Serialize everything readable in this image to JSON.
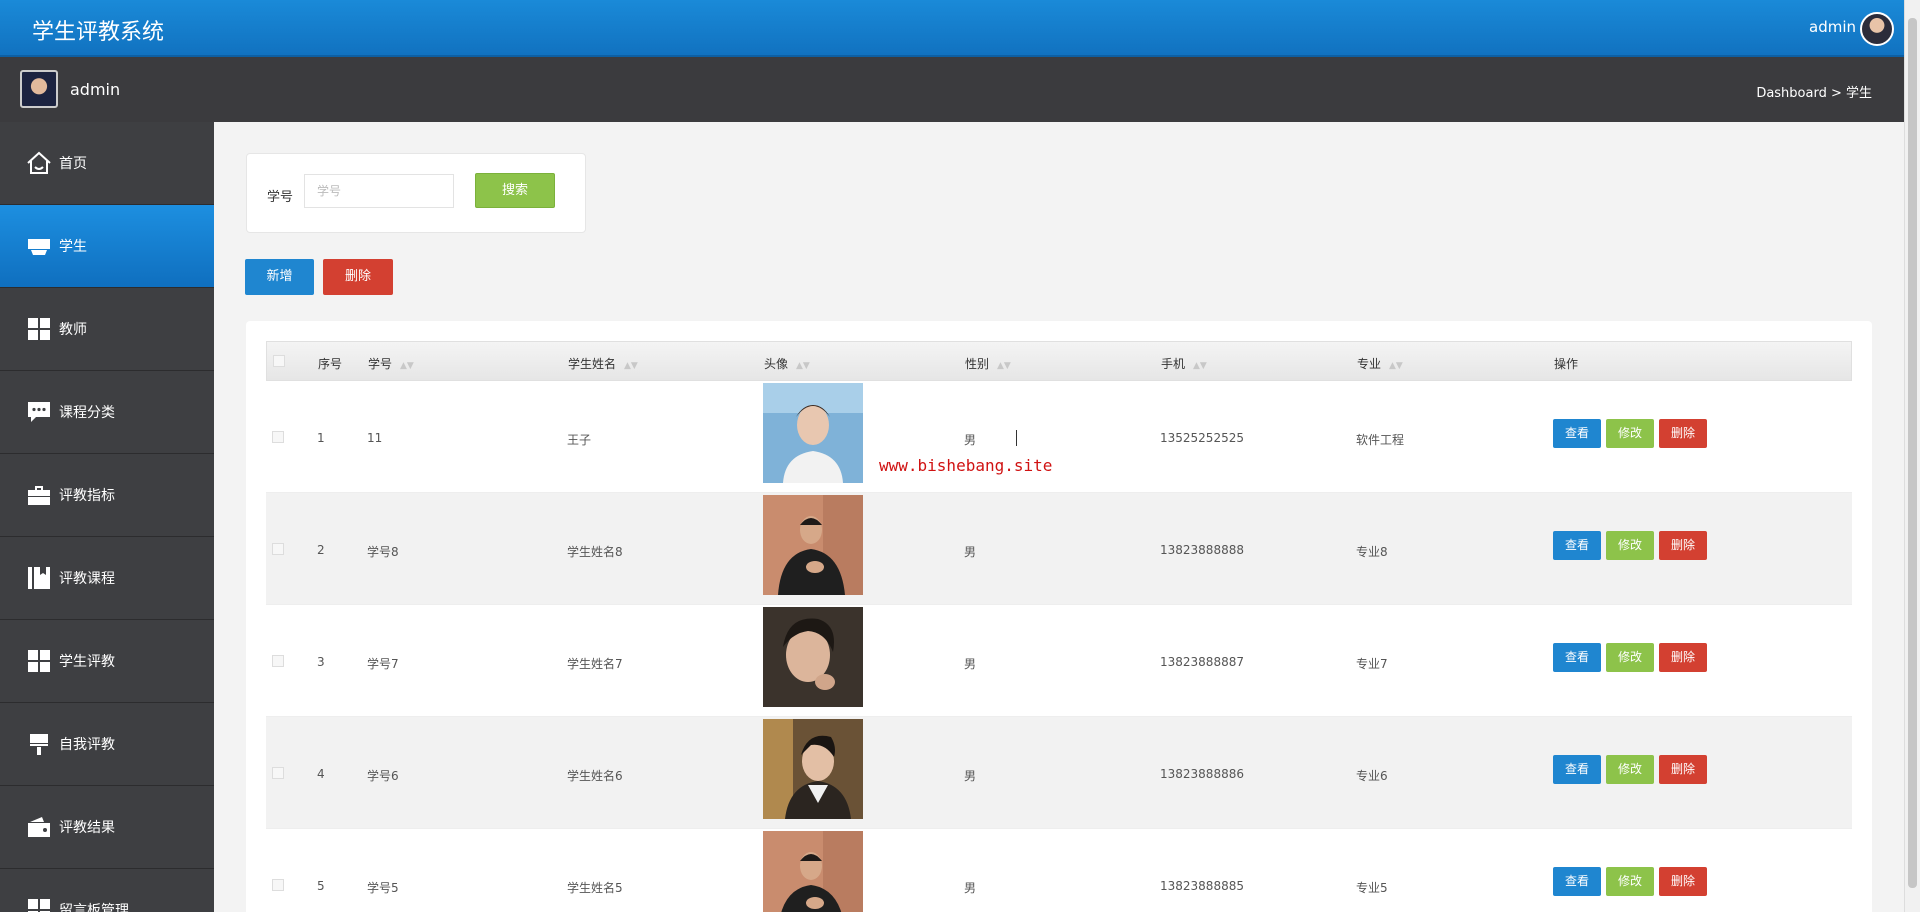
{
  "app": {
    "title": "学生评教系统",
    "user": "admin"
  },
  "subheader": {
    "username": "admin",
    "breadcrumb": "Dashboard > 学生"
  },
  "sidebar": {
    "items": [
      {
        "label": "首页",
        "icon": "home-icon"
      },
      {
        "label": "学生",
        "icon": "student-icon"
      },
      {
        "label": "教师",
        "icon": "grid-icon"
      },
      {
        "label": "课程分类",
        "icon": "chat-icon"
      },
      {
        "label": "评教指标",
        "icon": "briefcase-icon"
      },
      {
        "label": "评教课程",
        "icon": "book-icon"
      },
      {
        "label": "学生评教",
        "icon": "grid-icon"
      },
      {
        "label": "自我评教",
        "icon": "brush-icon"
      },
      {
        "label": "评教结果",
        "icon": "wallet-icon"
      },
      {
        "label": "留言板管理",
        "icon": "grid-icon"
      }
    ],
    "active_index": 1
  },
  "search": {
    "label": "学号",
    "placeholder": "学号",
    "button": "搜索"
  },
  "actions": {
    "add": "新增",
    "delete": "删除"
  },
  "table": {
    "headers": [
      "序号",
      "学号",
      "学生姓名",
      "头像",
      "性别",
      "手机",
      "专业",
      "操作"
    ],
    "row_buttons": {
      "view": "查看",
      "edit": "修改",
      "delete": "删除"
    },
    "rows": [
      {
        "index": "1",
        "student_id": "11",
        "name": "王子",
        "gender": "男",
        "phone": "13525252525",
        "major": "软件工程"
      },
      {
        "index": "2",
        "student_id": "学号8",
        "name": "学生姓名8",
        "gender": "男",
        "phone": "13823888888",
        "major": "专业8"
      },
      {
        "index": "3",
        "student_id": "学号7",
        "name": "学生姓名7",
        "gender": "男",
        "phone": "13823888887",
        "major": "专业7"
      },
      {
        "index": "4",
        "student_id": "学号6",
        "name": "学生姓名6",
        "gender": "男",
        "phone": "13823888886",
        "major": "专业6"
      },
      {
        "index": "5",
        "student_id": "学号5",
        "name": "学生姓名5",
        "gender": "男",
        "phone": "13823888885",
        "major": "专业5"
      }
    ]
  },
  "watermark": "www.bishebang.site",
  "colors": {
    "topbar": "#1a8ad8",
    "sidebar": "#3e3f42",
    "primary": "#1f86d0",
    "success": "#8dc34a",
    "danger": "#d34031"
  }
}
